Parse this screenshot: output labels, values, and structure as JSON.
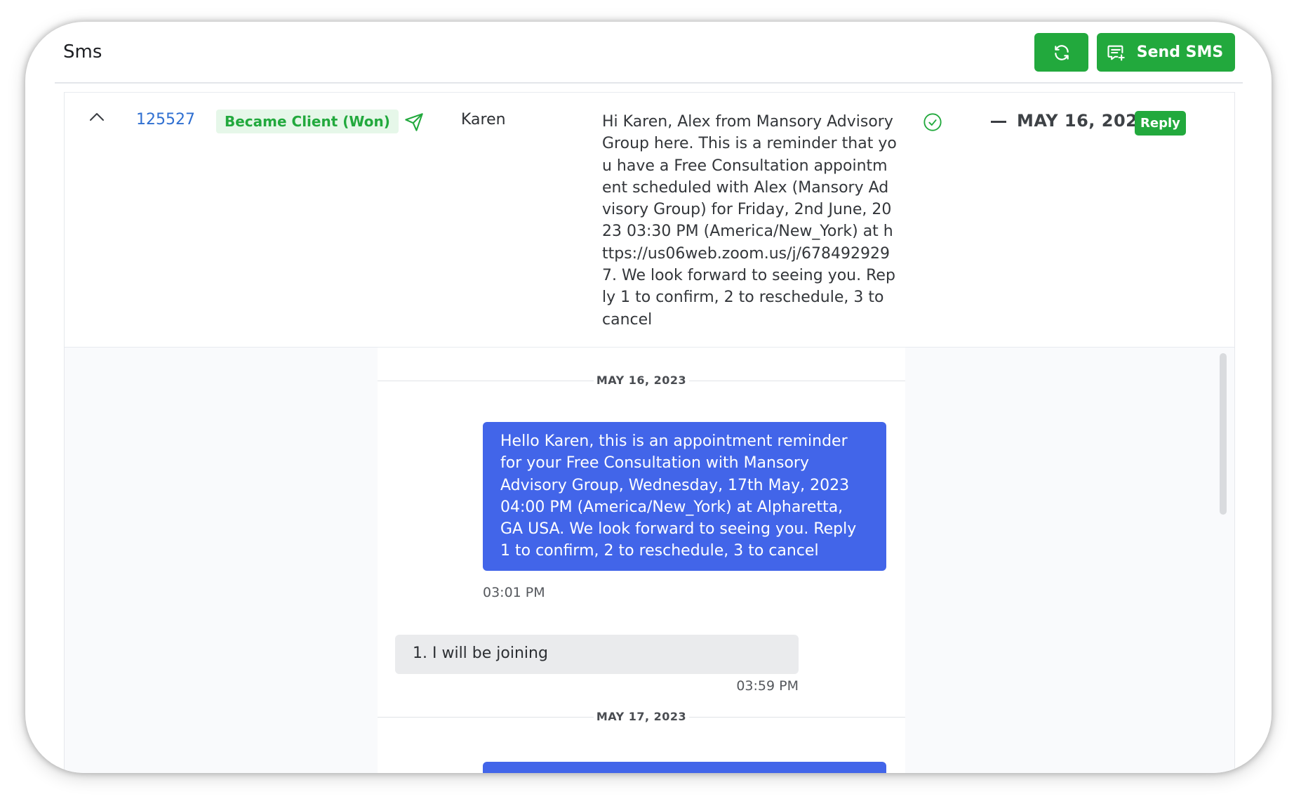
{
  "header": {
    "title": "Sms",
    "refresh_icon": "refresh-icon",
    "send_label": "Send SMS",
    "send_icon": "message-plus-icon"
  },
  "row": {
    "id": "125527",
    "status_badge": "Became Client (Won)",
    "name": "Karen",
    "message": "Hi Karen, Alex from Mansory Advisory Group here. This is a reminder that you have a Free Consultation appointment scheduled with Alex (Mansory Advisory Group) for Friday, 2nd June, 2023 03:30 PM (America/New_York) at https://us06web.zoom.us/j/6784929297. We look forward to seeing you. Reply 1 to confirm, 2 to reschedule, 3 to cancel",
    "date": "MAY 16, 2023",
    "reply_label": "Reply"
  },
  "thread": {
    "date_1": "MAY 16, 2023",
    "outgoing_message": "Hello Karen, this is an appointment reminder for your Free Consultation with Mansory Advisory Group, Wednesday, 17th May, 2023 04:00 PM (America/New_York) at Alpharetta, GA USA. We look forward to seeing you. Reply 1 to confirm, 2 to reschedule, 3 to cancel",
    "outgoing_time": "03:01 PM",
    "incoming_message": "1. I will be joining",
    "incoming_time": "03:59 PM",
    "date_2": "MAY 17, 2023"
  },
  "colors": {
    "green": "#22a93d",
    "blue": "#4265e9",
    "link": "#2f6fd1"
  }
}
